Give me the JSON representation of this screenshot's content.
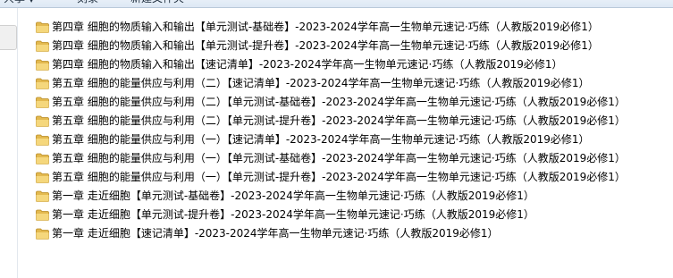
{
  "toolbar": {
    "share_label": "共享",
    "burn_label": "刻录",
    "new_folder_label": "新建文件夹"
  },
  "files": [
    {
      "name": "第四章 细胞的物质输入和输出【单元测试-基础卷】-2023-2024学年高一生物单元速记·巧练（人教版2019必修1）",
      "icon": "folder-icon"
    },
    {
      "name": "第四章 细胞的物质输入和输出【单元测试-提升卷】-2023-2024学年高一生物单元速记·巧练（人教版2019必修1）",
      "icon": "folder-icon"
    },
    {
      "name": "第四章 细胞的物质输入和输出【速记清单】-2023-2024学年高一生物单元速记·巧练（人教版2019必修1）",
      "icon": "folder-icon"
    },
    {
      "name": "第五章 细胞的能量供应与利用（二）【速记清单】-2023-2024学年高一生物单元速记·巧练（人教版2019必修1）",
      "icon": "folder-icon"
    },
    {
      "name": "第五章 细胞的能量供应与利用（二）【单元测试-基础卷】-2023-2024学年高一生物单元速记·巧练（人教版2019必修1）",
      "icon": "folder-icon"
    },
    {
      "name": "第五章 细胞的能量供应与利用（二）【单元测试-提升卷】-2023-2024学年高一生物单元速记·巧练（人教版2019必修1）",
      "icon": "folder-icon"
    },
    {
      "name": "第五章 细胞的能量供应与利用（一）【速记清单】-2023-2024学年高一生物单元速记·巧练（人教版2019必修1）",
      "icon": "folder-icon"
    },
    {
      "name": "第五章 细胞的能量供应与利用（一）【单元测试-基础卷】-2023-2024学年高一生物单元速记·巧练（人教版2019必修1）",
      "icon": "folder-icon"
    },
    {
      "name": "第五章 细胞的能量供应与利用（一）【单元测试-提升卷】-2023-2024学年高一生物单元速记·巧练（人教版2019必修1）",
      "icon": "folder-icon"
    },
    {
      "name": "第一章 走近细胞【单元测试-基础卷】-2023-2024学年高一生物单元速记·巧练（人教版2019必修1）",
      "icon": "folder-icon"
    },
    {
      "name": "第一章 走近细胞【单元测试-提升卷】-2023-2024学年高一生物单元速记·巧练（人教版2019必修1）",
      "icon": "folder-icon"
    },
    {
      "name": "第一章 走近细胞【速记清单】-2023-2024学年高一生物单元速记·巧练（人教版2019必修1）",
      "icon": "folder-icon"
    }
  ]
}
